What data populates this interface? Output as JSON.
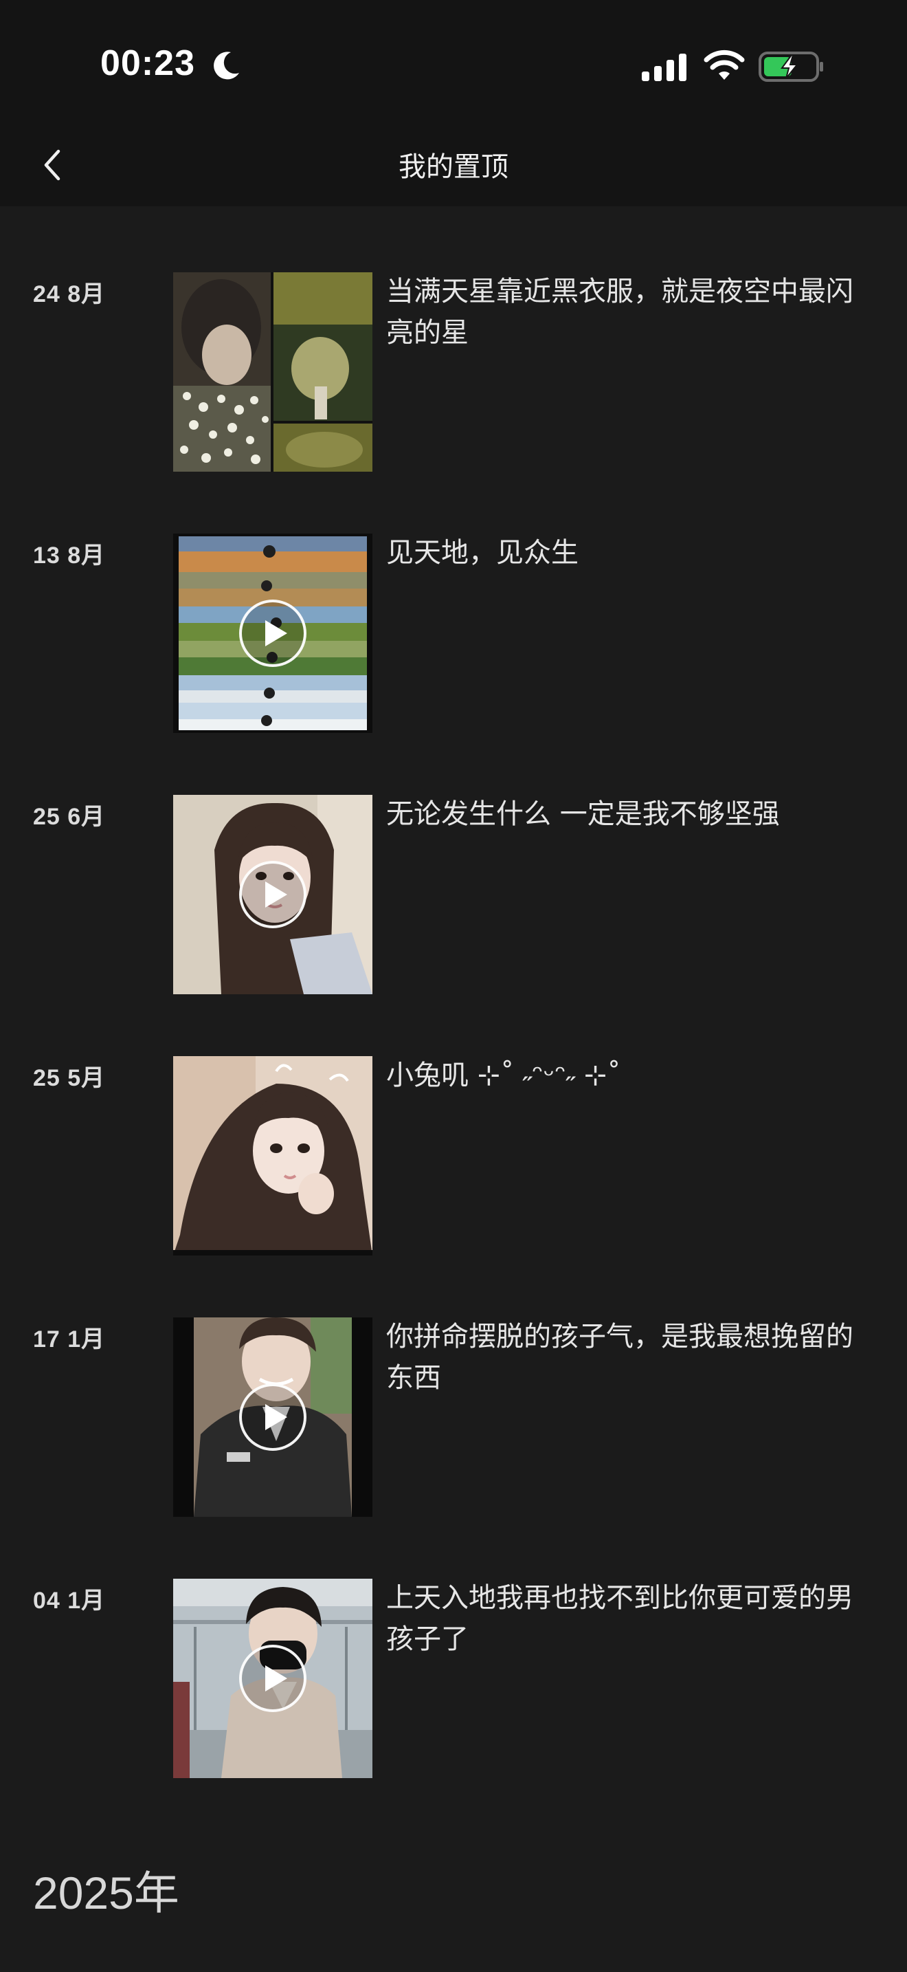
{
  "status_bar": {
    "time": "00:23"
  },
  "nav": {
    "title": "我的置顶"
  },
  "colors": {
    "background": "#1b1b1b",
    "bar_background": "#141414",
    "battery_green": "#34c759"
  },
  "icons": {
    "moon": "moon-icon",
    "signal": "signal-icon",
    "wifi": "wifi-icon",
    "battery": "battery-charging-icon",
    "back": "chevron-left-icon",
    "play": "play-icon"
  },
  "pinned_items": [
    {
      "date": "24 8月",
      "text": "当满天星靠近黑衣服，就是夜空中最闪亮的星",
      "media": "image"
    },
    {
      "date": "13 8月",
      "text": "见天地，见众生",
      "media": "video"
    },
    {
      "date": "25 6月",
      "text": "无论发生什么 一定是我不够坚强",
      "media": "video"
    },
    {
      "date": "25 5月",
      "text": "小兔叽 ⊹˚ ˶ᵔᵕᵔ˶ ⊹˚",
      "media": "image"
    },
    {
      "date": "17 1月",
      "text": "你拼命摆脱的孩子气，是我最想挽留的东西",
      "media": "video"
    },
    {
      "date": "04 1月",
      "text": "上天入地我再也找不到比你更可爱的男孩子了",
      "media": "video"
    }
  ],
  "year_section": {
    "label": "2025年"
  }
}
